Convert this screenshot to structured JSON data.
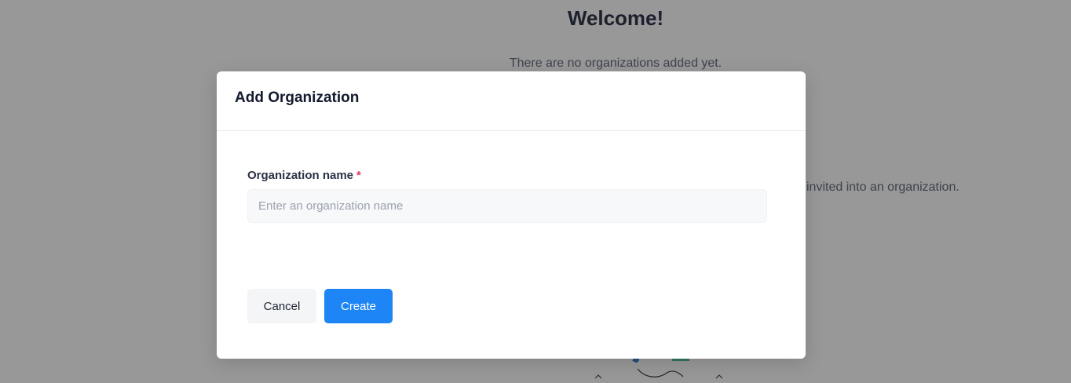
{
  "background": {
    "welcome_title": "Welcome!",
    "no_orgs_text": "There are no organizations added yet.",
    "invite_text": "invited into an organization."
  },
  "modal": {
    "title": "Add Organization",
    "field": {
      "label": "Organization name",
      "required_mark": "*",
      "placeholder": "Enter an organization name",
      "value": ""
    },
    "buttons": {
      "cancel": "Cancel",
      "create": "Create"
    }
  },
  "colors": {
    "primary": "#1d85f5",
    "required": "#e03560",
    "overlay": "rgba(30,30,30,0.46)"
  }
}
